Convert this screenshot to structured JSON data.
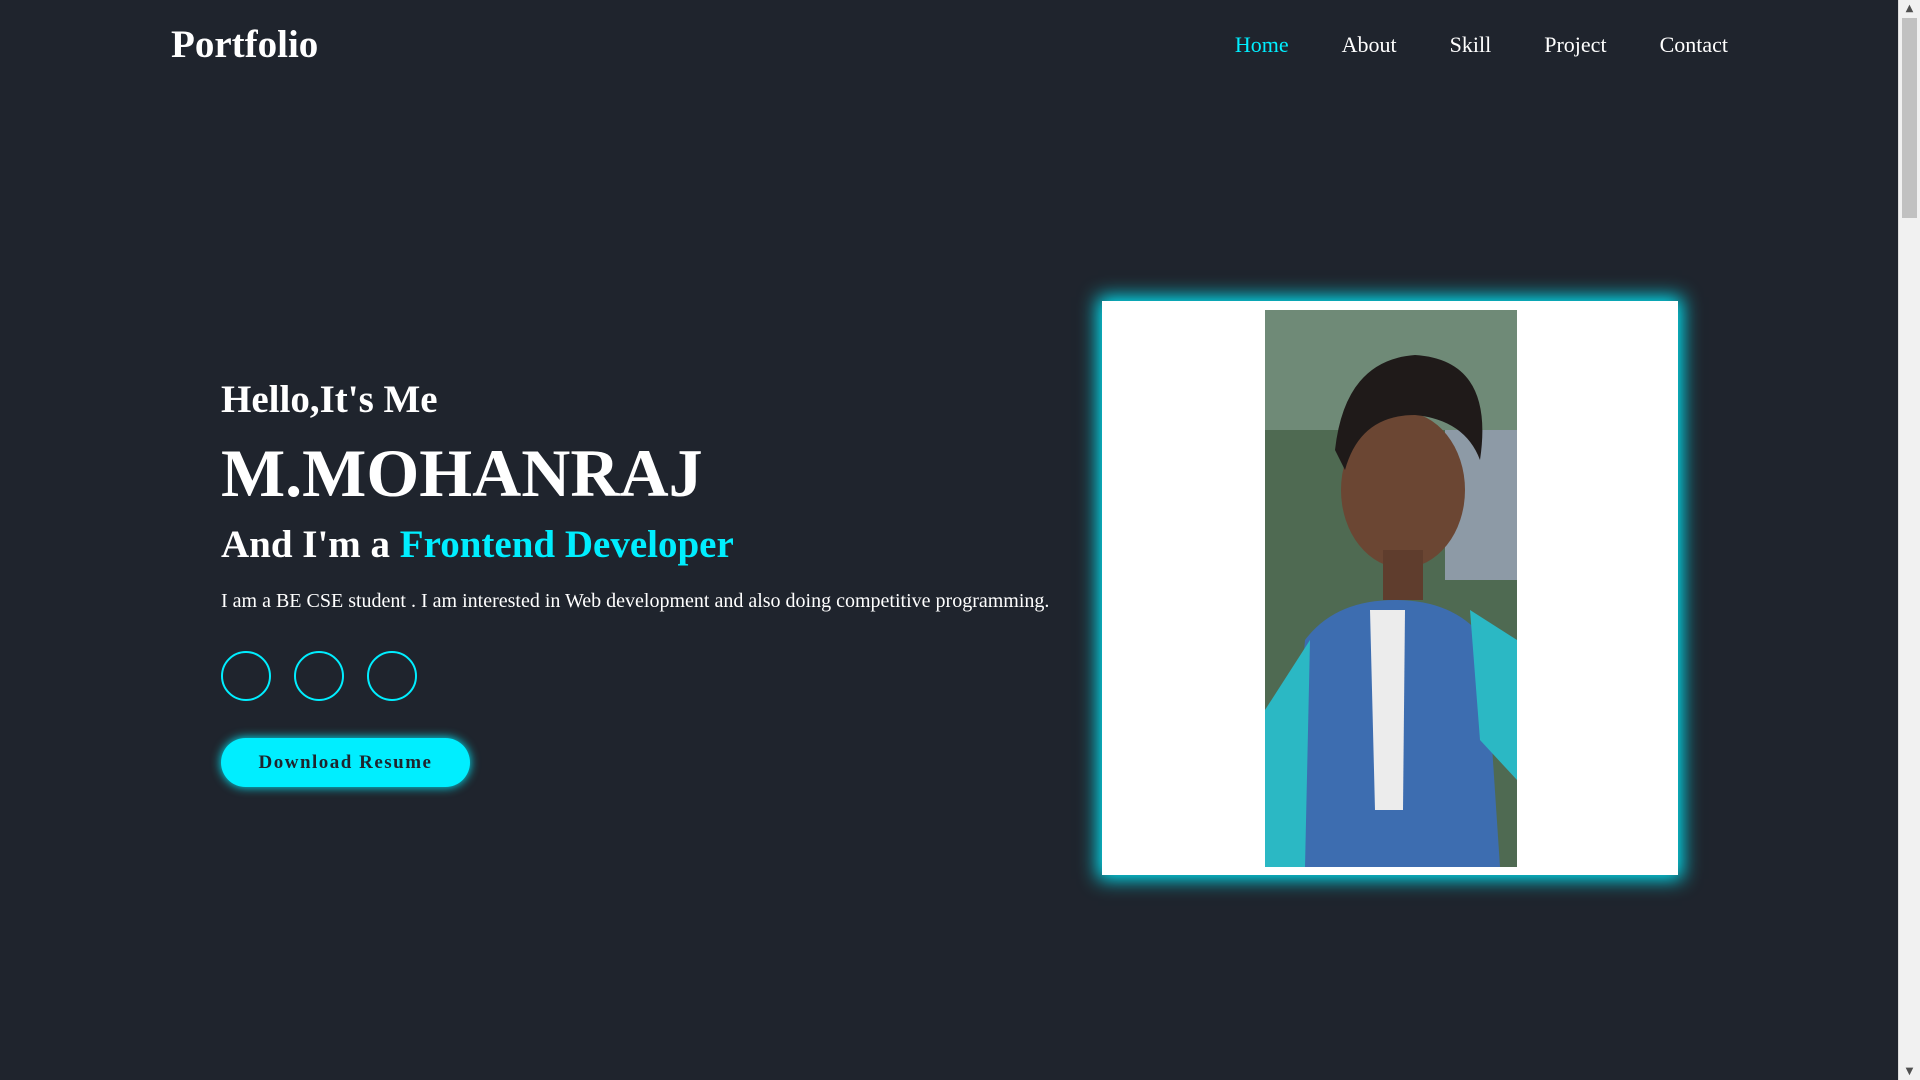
{
  "header": {
    "logo": "Portfolio",
    "nav": [
      {
        "label": "Home",
        "active": true
      },
      {
        "label": "About",
        "active": false
      },
      {
        "label": "Skill",
        "active": false
      },
      {
        "label": "Project",
        "active": false
      },
      {
        "label": "Contact",
        "active": false
      }
    ]
  },
  "hero": {
    "greeting": "Hello,It's Me",
    "name": "M.MOHANRAJ",
    "role_prefix": "And I'm a ",
    "role_highlight": "Frontend Developer",
    "description": "I am a BE CSE student . I am interested in Web development and also doing competitive programming.",
    "social_icons": [
      "social-icon-1",
      "social-icon-2",
      "social-icon-3"
    ],
    "button_label": "Download Resume"
  },
  "colors": {
    "background": "#1f242d",
    "accent": "#00eeff",
    "text": "#ffffff"
  }
}
